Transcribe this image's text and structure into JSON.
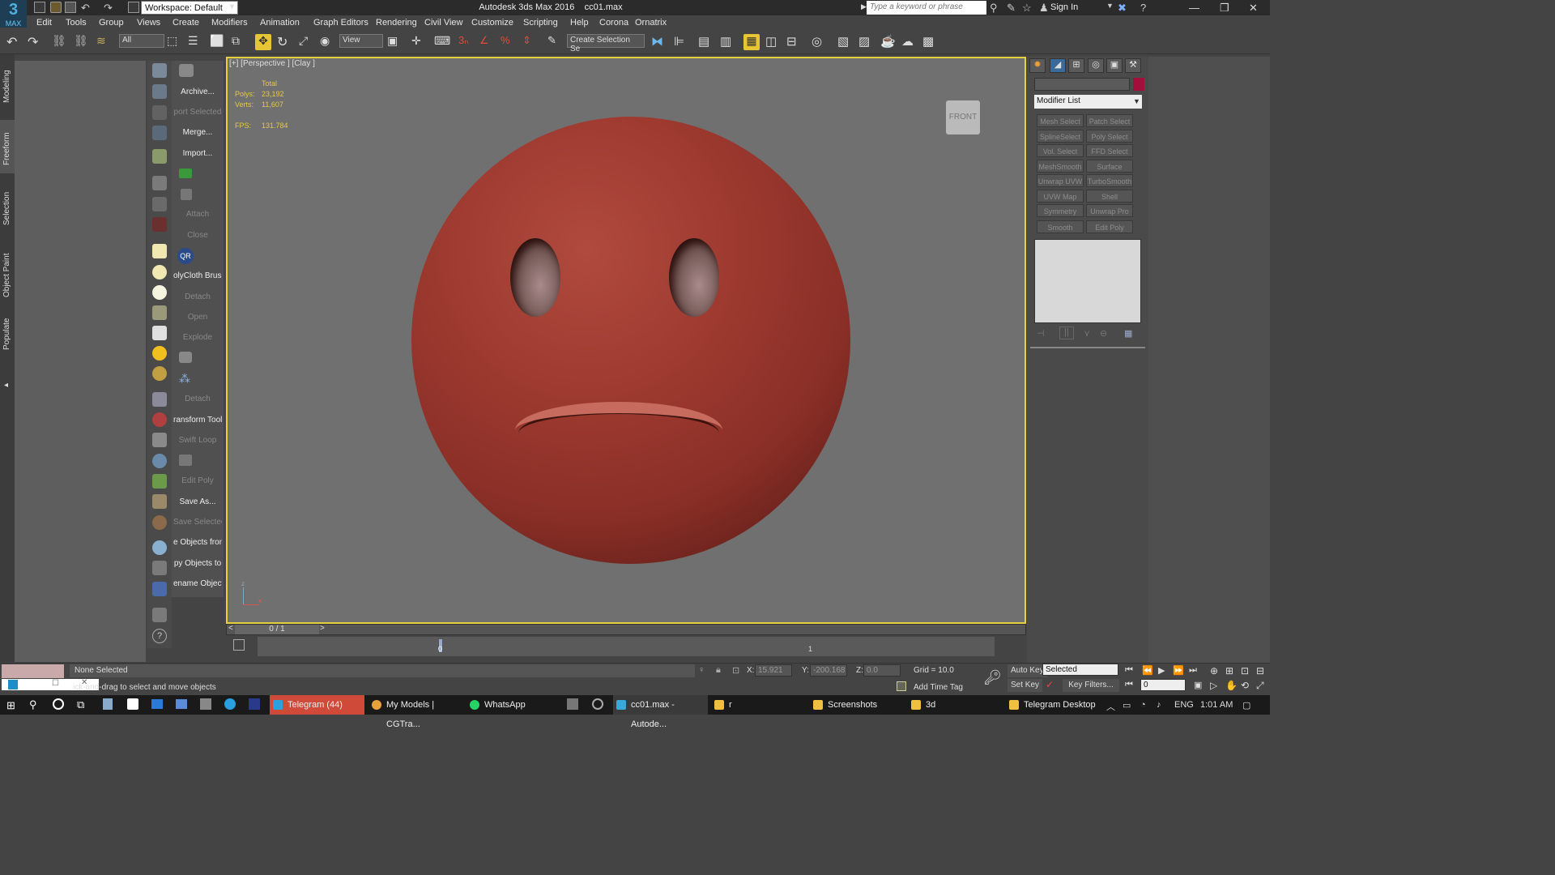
{
  "titlebar": {
    "workspace": "Workspace: Default",
    "app_title": "Autodesk 3ds Max 2016",
    "filename": "cc01.max",
    "search_placeholder": "Type a keyword or phrase",
    "sign_in": "Sign In",
    "logo_text": "MAX"
  },
  "menu": [
    "Edit",
    "Tools",
    "Group",
    "Views",
    "Create",
    "Modifiers",
    "Animation",
    "Graph Editors",
    "Rendering",
    "Civil View",
    "Customize",
    "Scripting",
    "Help",
    "Corona",
    "Ornatrix"
  ],
  "toolbar": {
    "filter": "All",
    "ref_coord": "View",
    "selection_set": "Create Selection Se"
  },
  "ribbon_tabs": [
    "Modeling",
    "Freeform",
    "Selection",
    "Object Paint",
    "Populate"
  ],
  "tool_labels": [
    {
      "text": "Archive...",
      "enabled": true
    },
    {
      "text": "port Selected",
      "enabled": false
    },
    {
      "text": "Merge...",
      "enabled": true
    },
    {
      "text": "Import...",
      "enabled": true
    },
    {
      "text": "Attach",
      "enabled": false
    },
    {
      "text": "Close",
      "enabled": false
    },
    {
      "text": "olyCloth Brush",
      "enabled": true
    },
    {
      "text": "Detach",
      "enabled": false
    },
    {
      "text": "Open",
      "enabled": false
    },
    {
      "text": "Explode",
      "enabled": false
    },
    {
      "text": "Detach",
      "enabled": false
    },
    {
      "text": "ransform Tool",
      "enabled": true
    },
    {
      "text": "Swift Loop",
      "enabled": false
    },
    {
      "text": "Edit Poly",
      "enabled": false
    },
    {
      "text": "Save As...",
      "enabled": true
    },
    {
      "text": "Save Selected",
      "enabled": false
    },
    {
      "text": "e Objects fron",
      "enabled": true
    },
    {
      "text": "py Objects to",
      "enabled": true
    },
    {
      "text": "ename Objects",
      "enabled": true
    }
  ],
  "qr_label": "QR",
  "viewport": {
    "label": "[+] [Perspective ] [Clay ]",
    "stats_header": "Total",
    "polys_label": "Polys:",
    "polys_value": "23,192",
    "verts_label": "Verts:",
    "verts_value": "11,607",
    "fps_label": "FPS:",
    "fps_value": "131.784",
    "viewcube": "FRONT",
    "axis_z": "z",
    "axis_x": "x"
  },
  "timeline": {
    "position": "0 / 1",
    "prev": "<",
    "next": ">",
    "tick0": "0",
    "tick1": "1"
  },
  "command_panel": {
    "modifier_list": "Modifier List",
    "modifiers": [
      "Mesh Select",
      "Patch Select",
      "SplineSelect",
      "Poly Select",
      "Vol. Select",
      "FFD Select",
      "MeshSmooth",
      "Surface Select",
      "Unwrap UVW",
      "TurboSmooth",
      "UVW Map",
      "Shell",
      "Symmetry",
      "Unwrap Pro",
      "Smooth",
      "Edit Poly"
    ],
    "object_color": "#a30f3a"
  },
  "status": {
    "selection": "None Selected",
    "prompt": "ick-and-drag to select and move objects",
    "x_label": "X:",
    "x_value": "15.921",
    "y_label": "Y:",
    "y_value": "-200.168",
    "z_label": "Z:",
    "z_value": "0.0",
    "grid": "Grid = 10.0",
    "add_time_tag": "Add Time Tag",
    "auto_key": "Auto Key",
    "set_key": "Set Key",
    "selected": "Selected",
    "key_filters": "Key Filters...",
    "frame": "0"
  },
  "taskbar": {
    "items": [
      {
        "label": "Telegram (44)",
        "color": "#2aa1da"
      },
      {
        "label": "My Models | CGTra...",
        "color": "#e8a13b"
      },
      {
        "label": "WhatsApp",
        "color": "#25d366"
      },
      {
        "label": "cc01.max - Autode...",
        "color": "#3aa7d8"
      },
      {
        "label": "r",
        "color": "#f0c040"
      },
      {
        "label": "Screenshots",
        "color": "#f0c040"
      },
      {
        "label": "3d",
        "color": "#f0c040"
      },
      {
        "label": "Telegram Desktop",
        "color": "#f0c040"
      }
    ],
    "lang": "ENG",
    "time": "1:01 AM"
  }
}
